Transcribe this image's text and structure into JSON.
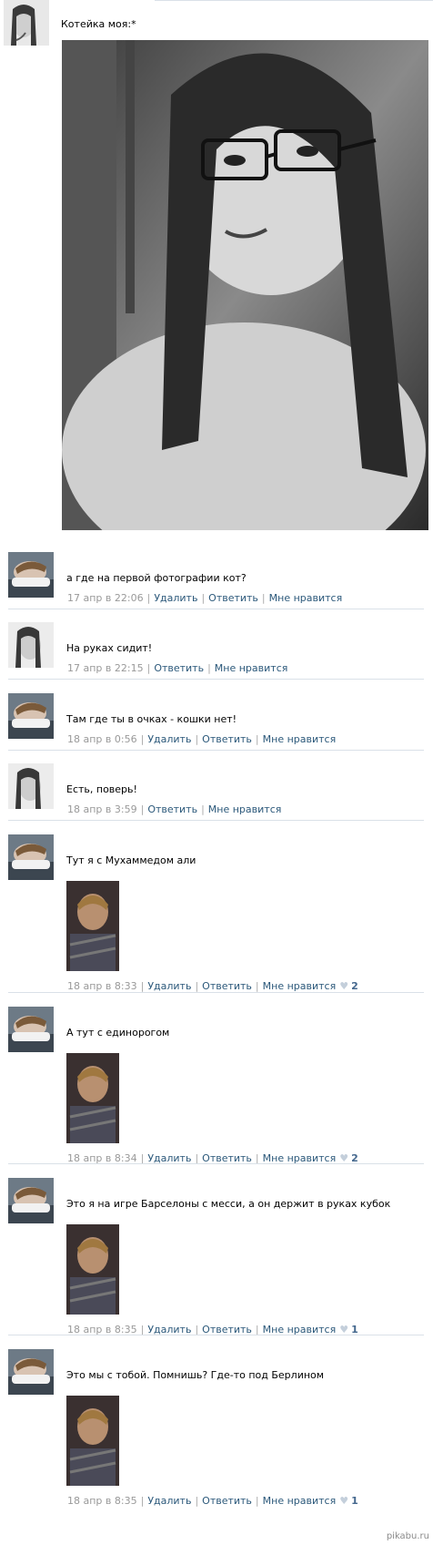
{
  "post": {
    "text": "Котейка моя:*"
  },
  "comments": [
    {
      "text": "а где на первой фотографии кот?",
      "date": "17 апр в 22:06",
      "actions": [
        "Удалить",
        "Ответить",
        "Мне нравится"
      ],
      "likes": "",
      "author": "boy"
    },
    {
      "text": "На руках сидит!",
      "date": "17 апр в 22:15",
      "actions": [
        "Ответить",
        "Мне нравится"
      ],
      "likes": "",
      "author": "girl"
    },
    {
      "text": "Там где ты в очках - кошки нет!",
      "date": "18 апр в 0:56",
      "actions": [
        "Удалить",
        "Ответить",
        "Мне нравится"
      ],
      "likes": "",
      "author": "boy"
    },
    {
      "text": "Есть, поверь!",
      "date": "18 апр в 3:59",
      "actions": [
        "Ответить",
        "Мне нравится"
      ],
      "likes": "",
      "author": "girl"
    },
    {
      "text": "Тут я с Мухаммедом али",
      "date": "18 апр в 8:33",
      "actions": [
        "Удалить",
        "Ответить",
        "Мне нравится"
      ],
      "likes": "2",
      "author": "boy"
    },
    {
      "text": "А тут с единорогом",
      "date": "18 апр в 8:34",
      "actions": [
        "Удалить",
        "Ответить",
        "Мне нравится"
      ],
      "likes": "2",
      "author": "boy"
    },
    {
      "text": "Это я на игре Барселоны с месси, а он держит в руках кубок",
      "date": "18 апр в 8:35",
      "actions": [
        "Удалить",
        "Ответить",
        "Мне нравится"
      ],
      "likes": "1",
      "author": "boy"
    },
    {
      "text": "Это мы с тобой. Помнишь? Где-то под Берлином",
      "date": "18 апр в 8:35",
      "actions": [
        "Удалить",
        "Ответить",
        "Мне нравится"
      ],
      "likes": "1",
      "author": "boy"
    }
  ],
  "watermark": "pikabu.ru",
  "colors": {
    "link": "#2b587a",
    "date": "#999999",
    "divider": "#dae1e8",
    "heart": "#c4cfdb"
  },
  "icons": {
    "like": "heart-icon"
  }
}
